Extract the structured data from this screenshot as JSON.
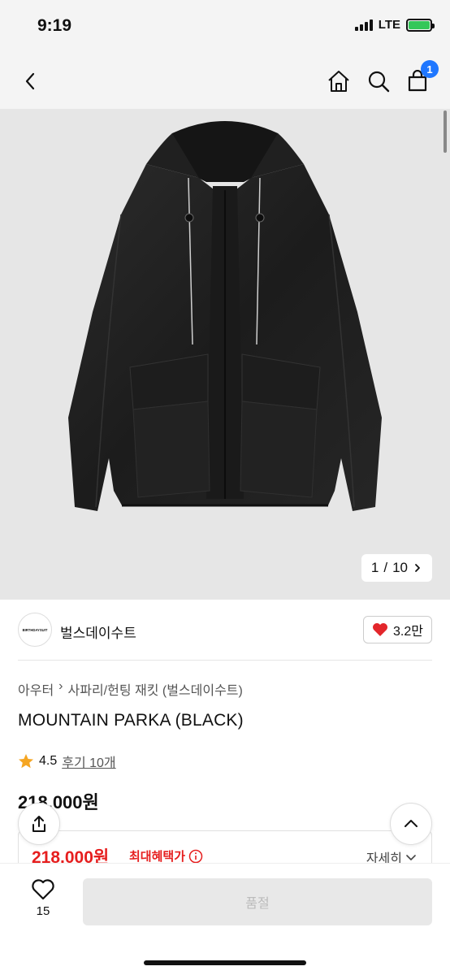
{
  "status_bar": {
    "time": "9:19",
    "network": "LTE"
  },
  "nav": {
    "cart_count": "1"
  },
  "gallery": {
    "current": "1",
    "total": "10",
    "separator": "/"
  },
  "seller": {
    "logo_text": "BIRTHDAYSUIT",
    "name": "벌스데이수트",
    "likes": "3.2만"
  },
  "product": {
    "breadcrumb": [
      "아우터",
      "사파리/헌팅 재킷 (벌스데이수트)"
    ],
    "title": "MOUNTAIN PARKA (BLACK)",
    "rating": "4.5",
    "review_link": "후기 10개",
    "price": "218,000원"
  },
  "benefit": {
    "price": "218,000원",
    "label": "최대혜택가",
    "detail": "자세히"
  },
  "bottom": {
    "wish_count": "15",
    "soldout_label": "품절"
  },
  "colors": {
    "accent_red": "#e61e1e",
    "badge_blue": "#1f77ff",
    "star": "#f5a623",
    "heart": "#e3262b"
  },
  "icons": [
    "back-icon",
    "home-icon",
    "search-icon",
    "cart-icon",
    "share-icon",
    "chevron-up-icon",
    "heart-icon",
    "star-icon",
    "info-icon"
  ]
}
